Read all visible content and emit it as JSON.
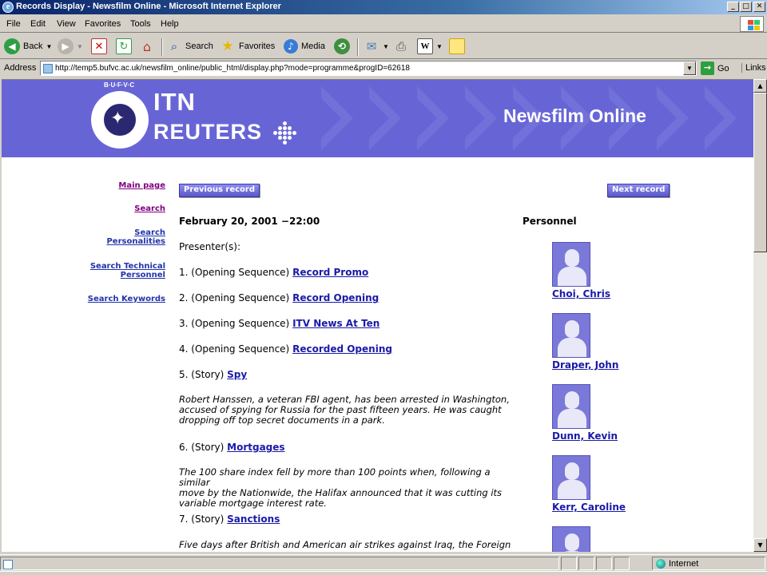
{
  "window": {
    "title": "Records Display - Newsfilm Online - Microsoft Internet Explorer",
    "controls": {
      "minimize": "_",
      "maximize": "□",
      "close": "✕"
    }
  },
  "menu": [
    "File",
    "Edit",
    "View",
    "Favorites",
    "Tools",
    "Help"
  ],
  "toolbar": {
    "back_label": "Back",
    "search_label": "Search",
    "favorites_label": "Favorites",
    "media_label": "Media"
  },
  "address": {
    "label": "Address",
    "url": "http://temp5.bufvc.ac.uk/newsfilm_online/public_html/display.php?mode=programme&progID=62618",
    "go_label": "Go",
    "links_label": "Links"
  },
  "banner": {
    "logo_letters": "B·U·F·V·C",
    "itn": "ITN",
    "reuters": "REUTERS",
    "site_title": "Newsfilm Online"
  },
  "sidenav": {
    "main_page": "Main page",
    "search": "Search",
    "search_personalities_1": "Search",
    "search_personalities_2": "Personalities",
    "search_technical_1": "Search Technical",
    "search_technical_2": "Personnel",
    "search_keywords": "Search Keywords"
  },
  "nav_buttons": {
    "previous": "Previous record",
    "next": "Next record"
  },
  "record": {
    "datetime": "February 20, 2001 −22:00",
    "presenters_label": "Presenter(s):",
    "items": [
      {
        "prefix": "1. (Opening Sequence)",
        "link": "Record Promo"
      },
      {
        "prefix": "2. (Opening Sequence)",
        "link": "Record Opening"
      },
      {
        "prefix": "3. (Opening Sequence)",
        "link": "ITV News At Ten"
      },
      {
        "prefix": "4. (Opening Sequence)",
        "link": "Recorded Opening"
      },
      {
        "prefix": "5. (Story)",
        "link": "Spy"
      },
      {
        "prefix": "6. (Story)",
        "link": "Mortgages"
      },
      {
        "prefix": "7. (Story)",
        "link": "Sanctions"
      }
    ],
    "summaries": {
      "spy_1": "Robert Hanssen, a veteran FBI agent, has been arrested in Washington,",
      "spy_2": "accused of spying for Russia for the past fifteen years. He was caught",
      "spy_3": "dropping off top secret documents in a park.",
      "mortgages_1": "The 100 share index fell by more than 100 points when, following a similar",
      "mortgages_2": "move by the Nationwide, the Halifax announced that it was cutting its",
      "mortgages_3": "variable mortgage interest rate.",
      "sanctions_1": "Five days after British and American air strikes against Iraq, the Foreign"
    }
  },
  "personnel": {
    "heading": "Personnel",
    "people": [
      "Choi, Chris",
      "Draper, John",
      "Dunn, Kevin",
      "Kerr, Caroline"
    ]
  },
  "status": {
    "zone": "Internet"
  }
}
